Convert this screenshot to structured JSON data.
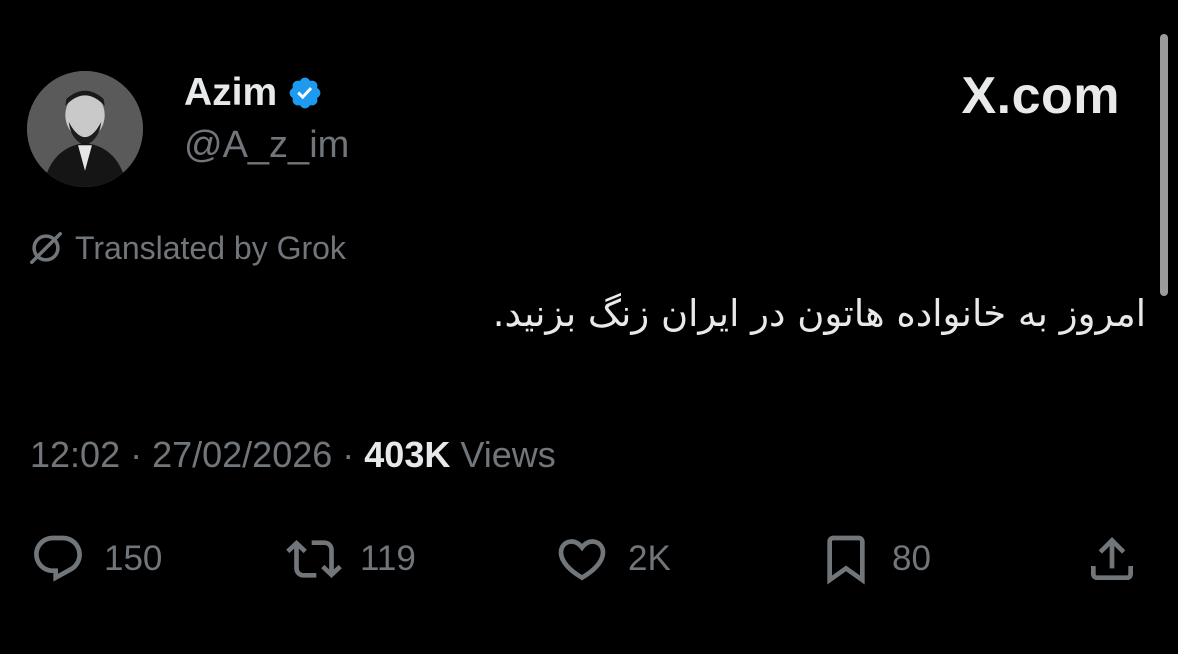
{
  "author": {
    "name": "Azim",
    "handle": "@A_z_im",
    "verified": true
  },
  "brand": "X.com",
  "translation_note": "Translated by Grok",
  "tweet_text": "امروز به خانواده هاتون در ایران زنگ بزنید.",
  "meta": {
    "time": "12:02",
    "separator": " · ",
    "date": "27/02/2026",
    "views_count": "403K",
    "views_label": " Views"
  },
  "actions": {
    "replies": "150",
    "reposts": "119",
    "likes": "2K",
    "bookmarks": "80"
  },
  "icons": {
    "verified": "verified-badge-icon",
    "grok": "grok-icon",
    "reply": "reply-icon",
    "repost": "repost-icon",
    "like": "heart-icon",
    "bookmark": "bookmark-icon",
    "share": "share-icon"
  },
  "colors": {
    "background": "#000000",
    "text_primary": "#e7e9ea",
    "text_secondary": "#71767b",
    "verified_blue": "#1d9bf0"
  }
}
